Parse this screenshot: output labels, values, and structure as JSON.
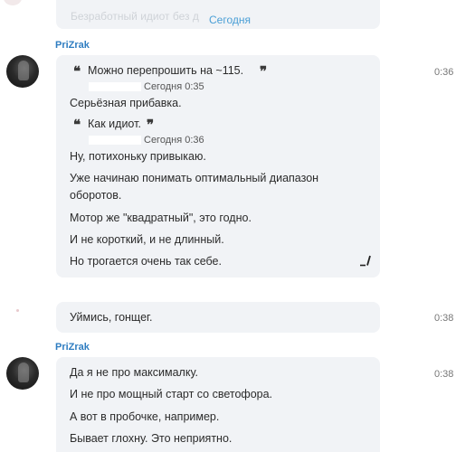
{
  "top": {
    "faded_preview": "Безработный идиот без д",
    "date_separator": "Сегодня"
  },
  "messages": [
    {
      "author": "PriZrak",
      "time": "0:36",
      "quotes": [
        {
          "text": "Можно перепрошить на ~115.",
          "meta": "Сегодня 0:35"
        },
        {
          "text": "Как идиот.",
          "meta": "Сегодня 0:36"
        }
      ],
      "after_quote_1": "Серьёзная прибавка.",
      "lines": [
        "Ну, потихоньку привыкаю.",
        "Уже начинаю понимать оптимальный диапазон",
        "оборотов.",
        "Мотор же \"квадратный\", это годно.",
        "И не короткий, и не длинный.",
        "Но трогается очень так себе."
      ]
    },
    {
      "author": "",
      "time": "0:38",
      "lines": [
        "Уймись, гонщег."
      ]
    },
    {
      "author": "PriZrak",
      "time": "0:38",
      "lines": [
        "Да я не про максималку.",
        "И не про мощный старт со светофора.",
        "А вот в пробочке, например.",
        "Бывает глохну. Это неприятно."
      ]
    }
  ]
}
